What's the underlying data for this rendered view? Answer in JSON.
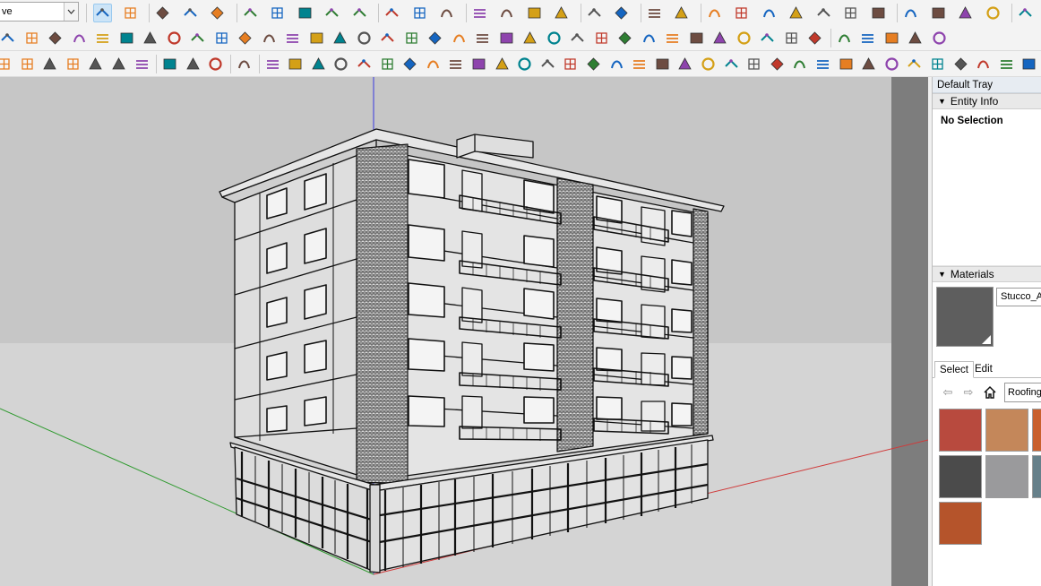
{
  "toolbar": {
    "style_combo": {
      "value": "ve"
    },
    "row1_icons": [
      "select-icon",
      "eraser-icon",
      "pencil-icon",
      "arc-icon",
      "paint-bucket-icon",
      "push-pull-icon",
      "follow-me-icon",
      "move-icon",
      "rotate-icon",
      "scale-icon",
      "tape-measure-icon",
      "text-icon",
      "paint-icon",
      "orbit-icon",
      "pan-icon",
      "zoom-icon",
      "zoom-extents-icon",
      "section-plane-icon",
      "layers-icon",
      "shadows-icon",
      "settings-icon",
      "user-icon",
      "warehouse-icon",
      "components-icon",
      "home-icon",
      "house-icon",
      "house-outline-icon",
      "building-icon",
      "stack-icon",
      "stack2-icon",
      "stack3-icon",
      "stack4-icon",
      "import-icon",
      "export-icon",
      "export2-icon"
    ],
    "row2_icons": [
      "ext-01-icon",
      "ext-02-icon",
      "ext-03-icon",
      "ext-04-icon",
      "ext-05-icon",
      "ext-06-icon",
      "ext-07-icon",
      "ext-08-icon",
      "ext-09-icon",
      "ext-10-icon",
      "ext-11-icon",
      "ext-12-icon",
      "ext-13-icon",
      "ext-14-icon",
      "ext-15-icon",
      "ext-16-icon",
      "ext-17-icon",
      "ext-18-icon",
      "ext-19-icon",
      "ext-20-icon",
      "ext-21-icon",
      "ext-22-icon",
      "ext-23-icon",
      "ext-24-icon",
      "ext-25-icon",
      "ext-26-icon",
      "ext-27-icon",
      "ext-28-icon",
      "ext-29-icon",
      "ext-30-icon",
      "ext-31-icon",
      "ext-32-icon",
      "ext-33-icon",
      "ext-34-icon",
      "ext-35-icon",
      "ext-36-icon",
      "ext-37-icon",
      "ext-38-icon",
      "ext-39-icon",
      "ext-40-icon"
    ],
    "row3_icons": [
      "refresh-icon",
      "plugin-icon",
      "add-circle-icon",
      "tree-icon",
      "gradient-icon",
      "checker-icon",
      "cloud-upload-icon",
      "gear-icon",
      "mail-icon",
      "info-icon",
      "tool-01-icon",
      "tool-02-icon",
      "tool-03-icon",
      "tool-04-icon",
      "tool-05-icon",
      "tool-06-icon",
      "tool-07-icon",
      "tool-08-icon",
      "tool-09-icon",
      "tool-10-icon",
      "tool-11-icon",
      "tool-12-icon",
      "tool-13-icon",
      "tool-14-icon",
      "tool-15-icon",
      "tool-16-icon",
      "tool-17-icon",
      "tool-18-icon",
      "tool-19-icon",
      "tool-20-icon",
      "tool-21-icon",
      "tool-22-icon",
      "tool-23-icon",
      "tool-24-icon",
      "tool-25-icon",
      "tool-26-icon",
      "tool-27-icon",
      "tool-28-icon",
      "tool-29-icon",
      "tool-30-icon",
      "tool-31-icon",
      "tool-32-icon",
      "tool-33-icon",
      "tool-34-icon",
      "tool-35-icon"
    ]
  },
  "tray": {
    "title": "Default Tray",
    "entity_info": {
      "header": "Entity Info",
      "status": "No Selection"
    },
    "materials": {
      "header": "Materials",
      "current_name": "Stucco_A",
      "current_color": "#5e5e5e",
      "tabs": [
        "Select",
        "Edit"
      ],
      "active_tab": "Select",
      "library": "Roofing",
      "thumbnails": [
        {
          "name": "roofing-red-icon",
          "color": "#b84a3e"
        },
        {
          "name": "roofing-shingle-tan-icon",
          "color": "#c4875a"
        },
        {
          "name": "roofing-shingle-orange-icon",
          "color": "#c9602d"
        },
        {
          "name": "roofing-slate-dark-icon",
          "color": "#4b4b4b"
        },
        {
          "name": "roofing-slate-grey-icon",
          "color": "#9a9a9c"
        },
        {
          "name": "roofing-slate-blue-icon",
          "color": "#66808a"
        },
        {
          "name": "roofing-tile-terracotta-icon",
          "color": "#b5542b"
        }
      ]
    }
  },
  "viewport": {
    "sky_color": "#c8c8c8",
    "ground_color": "#d3d3d3",
    "model_name": "building-model"
  }
}
